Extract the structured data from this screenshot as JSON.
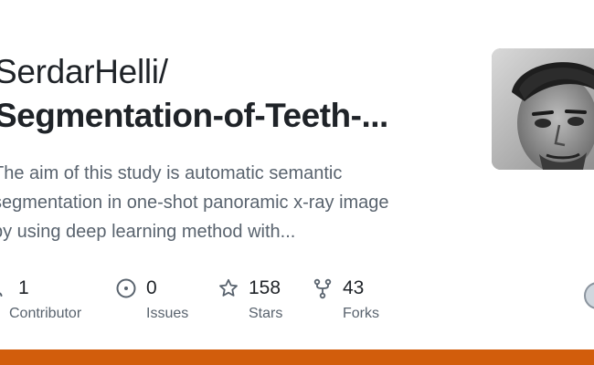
{
  "repo": {
    "owner_line": "SerdarHelli/",
    "name_line": "Segmentation-of-Teeth-...",
    "description_lines": [
      "The aim of this study is automatic semantic",
      "segmentation in one-shot panoramic x-ray image",
      "by using deep learning method with..."
    ]
  },
  "avatar": {
    "icon": "user-avatar-photo"
  },
  "stats": [
    {
      "icon": "people-icon",
      "value": "1",
      "label": "Contributor"
    },
    {
      "icon": "issue-icon",
      "value": "0",
      "label": "Issues"
    },
    {
      "icon": "star-icon",
      "value": "158",
      "label": "Stars"
    },
    {
      "icon": "fork-icon",
      "value": "43",
      "label": "Forks"
    }
  ],
  "colors": {
    "accent_bar": "#d25d0c",
    "text_primary": "#1f2328",
    "text_secondary": "#59636e"
  }
}
